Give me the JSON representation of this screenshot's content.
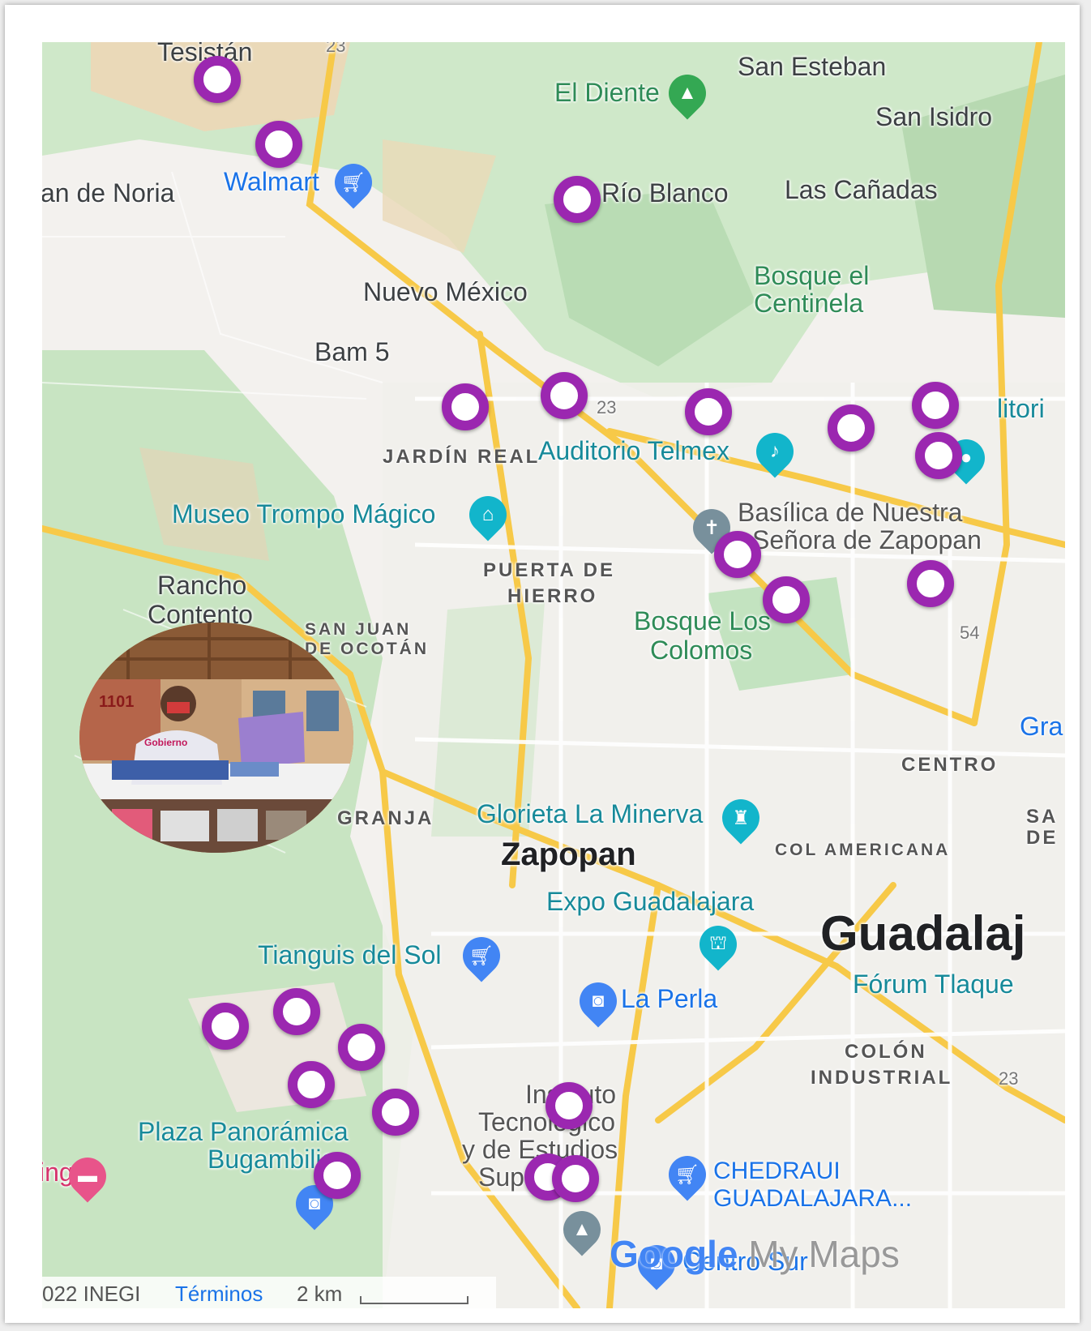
{
  "map": {
    "places": {
      "tesistan": "Tesistán",
      "san_esteban": "San Esteban",
      "el_diente": "El Diente",
      "san_isidro": "San Isidro",
      "walmart": "Walmart",
      "noria": "an de Noria",
      "rio_blanco": "Río Blanco",
      "las_canadas": "Las Cañadas",
      "bosque_centinela_1": "Bosque el",
      "bosque_centinela_2": "Centinela",
      "nuevo_mexico": "Nuevo México",
      "bam5": "Bam 5",
      "jardin_real": "JARDÍN REAL",
      "auditorio_telmex": "Auditorio Telmex",
      "auditorio_partial": "litori",
      "museo_trompo": "Museo Trompo Mágico",
      "basilica_1": "Basílica de Nuestra",
      "basilica_2": "Señora de Zapopan",
      "puerta_hierro_1": "PUERTA DE",
      "puerta_hierro_2": "HIERRO",
      "rancho_1": "Rancho",
      "rancho_2": "Contento",
      "san_juan_1": "SAN JUAN",
      "san_juan_2": "DE OCOTÁN",
      "bosque_colomos_1": "Bosque Los",
      "bosque_colomos_2": "Colomos",
      "gra_partial": "Gra",
      "centro": "CENTRO",
      "granja": "GRANJA",
      "glorieta": "Glorieta La Minerva",
      "san_partial_1": "SA",
      "san_partial_2": "DE",
      "zapopan": "Zapopan",
      "col_americana": "COL AMERICANA",
      "expo_guadalajara": "Expo Guadalajara",
      "guadalajara": "Guadalaj",
      "tianguis": "Tianguis del Sol",
      "forum": "Fórum Tlaque",
      "la_perla": "La Perla",
      "colon_1": "COLÓN",
      "colon_2": "INDUSTRIAL",
      "instituto_1": "Instituto",
      "instituto_2": "Tecnológico",
      "instituto_3": "y de Estudios",
      "instituto_4": "Sup...s...",
      "plaza_1": "Plaza Panorámica",
      "plaza_2": "Bugambilias",
      "ing_partial": "ing",
      "chedraui_1": "CHEDRAUI",
      "chedraui_2": "GUADALAJARA...",
      "centro_sur": "Centro Sur"
    },
    "road_shields": [
      "23",
      "23",
      "54",
      "23"
    ],
    "footer": {
      "copyright": "022 INEGI",
      "terms": "Términos",
      "scale": "2 km"
    },
    "brand": {
      "google": "Google",
      "mymaps": " My Maps"
    },
    "photo_text": {
      "sign_number": "1101",
      "shirt_text": "Gobierno"
    },
    "colors": {
      "marker": "#9b27b0",
      "road_major": "#f7c948",
      "park": "#c8e6c9"
    }
  }
}
